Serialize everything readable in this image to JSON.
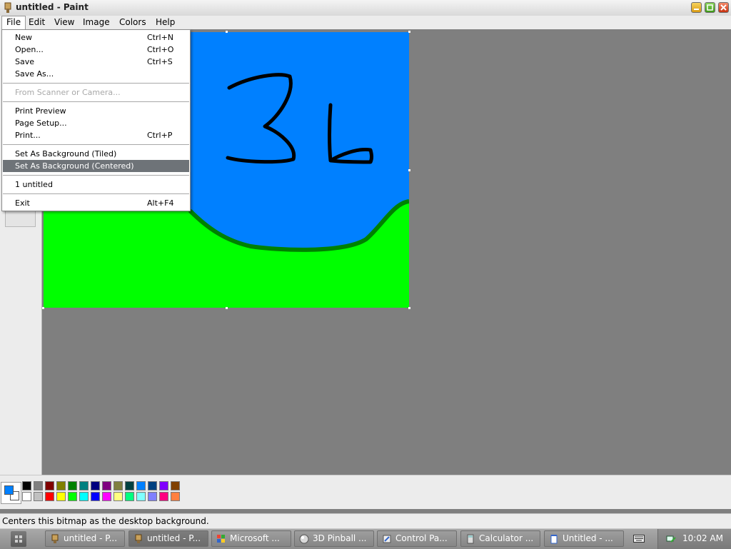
{
  "window": {
    "title": "untitled - Paint"
  },
  "menubar": {
    "items": [
      {
        "label": "File"
      },
      {
        "label": "Edit"
      },
      {
        "label": "View"
      },
      {
        "label": "Image"
      },
      {
        "label": "Colors"
      },
      {
        "label": "Help"
      }
    ]
  },
  "file_menu": {
    "items": [
      {
        "label": "New",
        "shortcut": "Ctrl+N"
      },
      {
        "label": "Open...",
        "shortcut": "Ctrl+O"
      },
      {
        "label": "Save",
        "shortcut": "Ctrl+S"
      },
      {
        "label": "Save As...",
        "shortcut": ""
      },
      {
        "label": "From Scanner or Camera...",
        "shortcut": "",
        "disabled": true
      },
      {
        "label": "Print Preview",
        "shortcut": ""
      },
      {
        "label": "Page Setup...",
        "shortcut": ""
      },
      {
        "label": "Print...",
        "shortcut": "Ctrl+P"
      },
      {
        "label": "Set As Background (Tiled)",
        "shortcut": ""
      },
      {
        "label": "Set As Background (Centered)",
        "shortcut": "",
        "highlighted": true
      },
      {
        "label": "1 untitled",
        "shortcut": ""
      },
      {
        "label": "Exit",
        "shortcut": "Alt+F4"
      }
    ]
  },
  "canvas": {
    "sky_color": "#0080ff",
    "ground_color": "#00ff00",
    "outline_color": "#008000",
    "drawing_ink": "#000000"
  },
  "palette": {
    "foreground": "#0080ff",
    "background": "#ffffff",
    "top_row": [
      "#000000",
      "#808080",
      "#800000",
      "#808000",
      "#008000",
      "#008080",
      "#000080",
      "#800080",
      "#808040",
      "#004040",
      "#0080ff",
      "#004080",
      "#8000ff",
      "#804000"
    ],
    "bottom_row": [
      "#ffffff",
      "#c0c0c0",
      "#ff0000",
      "#ffff00",
      "#00ff00",
      "#00ffff",
      "#0000ff",
      "#ff00ff",
      "#ffff80",
      "#00ff80",
      "#80ffff",
      "#8080ff",
      "#ff0080",
      "#ff8040"
    ]
  },
  "status": {
    "text": "Centers this bitmap as the desktop background."
  },
  "taskbar": {
    "tasks": [
      {
        "label": "untitled - P...",
        "icon": "paint-icon"
      },
      {
        "label": "untitled - P...",
        "icon": "paint-icon",
        "active": true
      },
      {
        "label": "Microsoft ...",
        "icon": "microsoft-icon"
      },
      {
        "label": "3D Pinball ...",
        "icon": "pinball-icon"
      },
      {
        "label": "Control Pa...",
        "icon": "control-panel-icon"
      },
      {
        "label": "Calculator ...",
        "icon": "calculator-icon"
      },
      {
        "label": "Untitled - ...",
        "icon": "notepad-icon"
      }
    ],
    "clock": "10:02 AM"
  }
}
